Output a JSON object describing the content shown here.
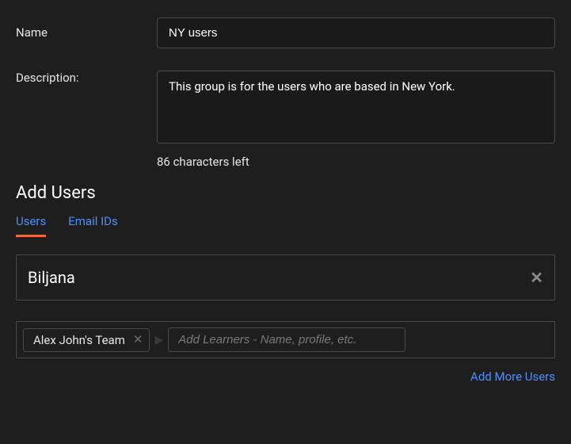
{
  "fields": {
    "name": {
      "label": "Name",
      "value": "NY users"
    },
    "description": {
      "label": "Description:",
      "value": "This group is for the users who are based in New York.",
      "counter": "86 characters left"
    }
  },
  "addUsers": {
    "heading": "Add Users",
    "tabs": {
      "users": "Users",
      "emailIds": "Email IDs"
    },
    "search": {
      "value": "Biljana"
    },
    "chip": {
      "label": "Alex John's Team"
    },
    "learnerPlaceholder": "Add Learners - Name, profile, etc.",
    "addMore": "Add More Users"
  }
}
